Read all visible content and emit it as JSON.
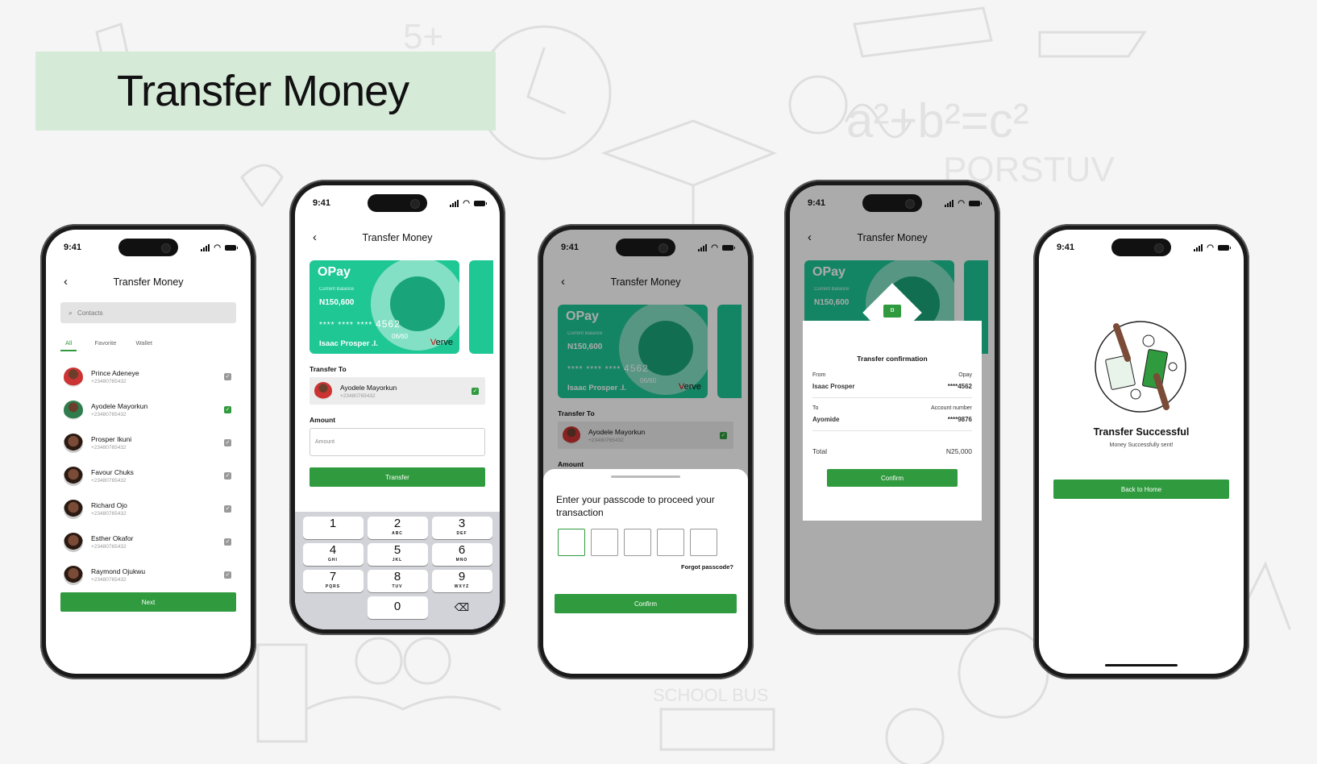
{
  "page": {
    "title": "Transfer Money"
  },
  "accent": "#2f9a3e",
  "status_time": "9:41",
  "screen1": {
    "title": "Transfer Money",
    "search_placeholder": "Contacts",
    "tabs": [
      "All",
      "Favorite",
      "Wallet"
    ],
    "contacts": [
      {
        "name": "Prince Adeneye",
        "phone": "+23480765432",
        "checked": false
      },
      {
        "name": "Ayodele Mayorkun",
        "phone": "+23480765432",
        "checked": true
      },
      {
        "name": "Prosper Ikuni",
        "phone": "+23480765432",
        "checked": false
      },
      {
        "name": "Favour Chuks",
        "phone": "+23480765432",
        "checked": false
      },
      {
        "name": "Richard Ojo",
        "phone": "+23480765432",
        "checked": false
      },
      {
        "name": "Esther Okafor",
        "phone": "+23480765432",
        "checked": false
      },
      {
        "name": "Raymond Ojukwu",
        "phone": "+23480765432",
        "checked": false
      }
    ],
    "next_label": "Next"
  },
  "card": {
    "brand": "OPay",
    "balance_label": "Current Balance",
    "balance": "N150,600",
    "number_masked": "**** ****  ****",
    "number_last": "4562",
    "expiry": "06/60",
    "holder": "Isaac Prosper .I.",
    "network": "Verve"
  },
  "screen2": {
    "title": "Transfer Money",
    "transfer_to_label": "Transfer To",
    "recipient_name": "Ayodele Mayorkun",
    "recipient_phone": "+23480765432",
    "amount_label": "Amount",
    "amount_placeholder": "Amount",
    "transfer_label": "Transfer",
    "keys": [
      [
        {
          "d": "1",
          "l": ""
        },
        {
          "d": "2",
          "l": "ABC"
        },
        {
          "d": "3",
          "l": "DEF"
        }
      ],
      [
        {
          "d": "4",
          "l": "GHI"
        },
        {
          "d": "5",
          "l": "JKL"
        },
        {
          "d": "6",
          "l": "MNO"
        }
      ],
      [
        {
          "d": "7",
          "l": "PQRS"
        },
        {
          "d": "8",
          "l": "TUV"
        },
        {
          "d": "9",
          "l": "WXYZ"
        }
      ]
    ],
    "zero": "0",
    "delete_icon": "⌫"
  },
  "screen3": {
    "title": "Transfer Money",
    "transfer_to_label": "Transfer To",
    "recipient_name": "Ayodele Mayorkun",
    "recipient_phone": "+23480765432",
    "amount_label": "Amount",
    "prompt": "Enter your passcode to proceed your transaction",
    "forgot": "Forgot passcode?",
    "confirm_label": "Confirm"
  },
  "screen4": {
    "title": "Transfer Money",
    "heading": "Transfer confirmation",
    "from_label": "From",
    "from_bank": "Opay",
    "from_name": "Isaac Prosper",
    "from_acct": "****4562",
    "to_label": "To",
    "to_acct_label": "Account number",
    "to_name": "Ayomide",
    "to_acct": "****9876",
    "total_label": "Total",
    "total_value": "N25,000",
    "confirm_label": "Confirm"
  },
  "screen5": {
    "heading": "Transfer Successful",
    "sub": "Money Successfully sent!",
    "home_label": "Back to Home"
  }
}
